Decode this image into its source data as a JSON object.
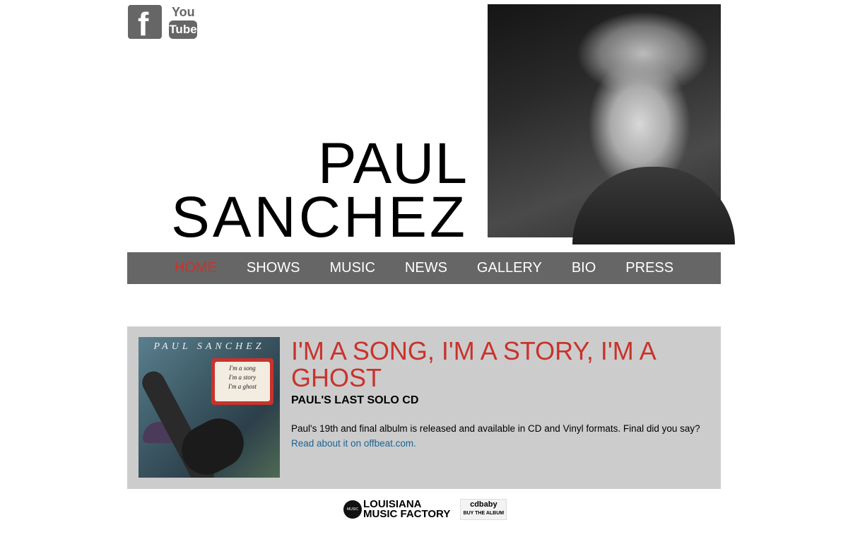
{
  "social": {
    "facebook_glyph": "f",
    "youtube_top": "You",
    "youtube_bottom": "Tube"
  },
  "site": {
    "name_first": "PAUL",
    "name_last": "SANCHEZ"
  },
  "nav": {
    "items": [
      {
        "label": "HOME",
        "active": true
      },
      {
        "label": "SHOWS"
      },
      {
        "label": "MUSIC"
      },
      {
        "label": "NEWS"
      },
      {
        "label": "GALLERY"
      },
      {
        "label": "BIO"
      },
      {
        "label": "PRESS"
      }
    ]
  },
  "feature": {
    "album_artist": "PAUL SANCHEZ",
    "album_lines": [
      "I'm a song",
      "I'm a story",
      "I'm a ghost"
    ],
    "title": "I'M A SONG, I'M A STORY, I'M A GHOST",
    "subtitle": "PAUL'S LAST SOLO CD",
    "body": "Paul's 19th and final albulm is released and available in CD and Vinyl formats.  Final did you say?  ",
    "link_text": "Read about it on offbeat.com."
  },
  "sponsors": {
    "lmf_disc": "MUSIC FACTORY",
    "lmf_line1": "LOUISIANA",
    "lmf_line2": "MUSIC FACTORY",
    "cdbaby_logo": "cdbaby",
    "cdbaby_cta": "BUY THE ALBUM"
  },
  "colors": {
    "accent_red": "#c8332c",
    "nav_bg": "#666666",
    "feature_bg": "#cccccc",
    "link_blue": "#1a6496"
  }
}
